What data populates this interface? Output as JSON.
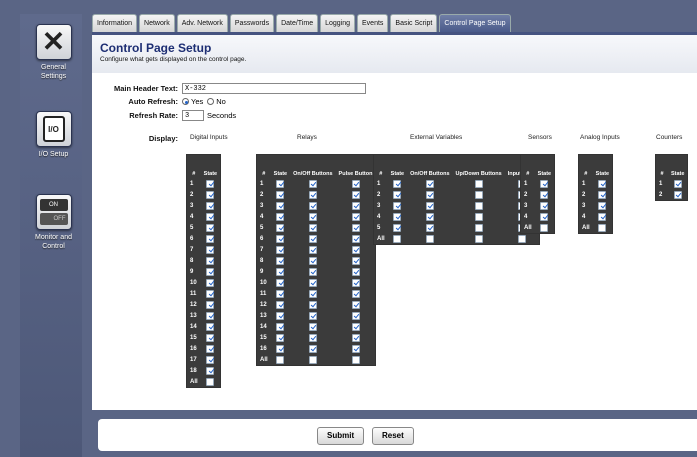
{
  "sidebar": [
    {
      "label": "General Settings",
      "icon": "tools-icon",
      "top": 0
    },
    {
      "label": "I/O Setup",
      "icon": "io-icon",
      "top": 0
    },
    {
      "label": "Monitor and Control",
      "icon": "toggle-icon",
      "top": 0
    }
  ],
  "tabs": [
    "Information",
    "Network",
    "Adv. Network",
    "Passwords",
    "Date/Time",
    "Logging",
    "Events",
    "Basic Script",
    "Control Page Setup"
  ],
  "active_tab": "Control Page Setup",
  "icons": {
    "io": "I/O",
    "on": "ON",
    "off": "OFF"
  },
  "page": {
    "title": "Control Page Setup",
    "subtitle": "Configure what gets displayed on the control page."
  },
  "form": {
    "header_label": "Main Header Text:",
    "header_value": "X-332",
    "refresh_label": "Auto Refresh:",
    "yes": "Yes",
    "no": "No",
    "refresh_selected": "Yes",
    "rate_label": "Refresh Rate:",
    "rate_value": "3",
    "rate_unit": "Seconds",
    "display_label": "Display:"
  },
  "groups": {
    "digital_inputs": {
      "title": "Digital Inputs",
      "headers": [
        "#",
        "State"
      ],
      "rows": [
        "1",
        "2",
        "3",
        "4",
        "5",
        "6",
        "7",
        "8",
        "9",
        "10",
        "11",
        "12",
        "13",
        "14",
        "15",
        "16",
        "17",
        "18",
        "All"
      ],
      "checked": [
        [
          1
        ],
        [
          1
        ],
        [
          1
        ],
        [
          1
        ],
        [
          1
        ],
        [
          1
        ],
        [
          1
        ],
        [
          1
        ],
        [
          1
        ],
        [
          1
        ],
        [
          1
        ],
        [
          1
        ],
        [
          1
        ],
        [
          1
        ],
        [
          1
        ],
        [
          1
        ],
        [
          1
        ],
        [
          1
        ],
        [
          0
        ]
      ]
    },
    "relays": {
      "title": "Relays",
      "headers": [
        "#",
        "State",
        "On/Off Buttons",
        "Pulse Button"
      ],
      "rows": [
        "1",
        "2",
        "3",
        "4",
        "5",
        "6",
        "7",
        "8",
        "9",
        "10",
        "11",
        "12",
        "13",
        "14",
        "15",
        "16",
        "All"
      ],
      "checked": [
        [
          1,
          1,
          1
        ],
        [
          1,
          1,
          1
        ],
        [
          1,
          1,
          1
        ],
        [
          1,
          1,
          1
        ],
        [
          1,
          1,
          1
        ],
        [
          1,
          1,
          1
        ],
        [
          1,
          1,
          1
        ],
        [
          1,
          1,
          1
        ],
        [
          1,
          1,
          1
        ],
        [
          1,
          1,
          1
        ],
        [
          1,
          1,
          1
        ],
        [
          1,
          1,
          1
        ],
        [
          1,
          1,
          1
        ],
        [
          1,
          1,
          1
        ],
        [
          1,
          1,
          1
        ],
        [
          1,
          1,
          1
        ],
        [
          0,
          0,
          0
        ]
      ]
    },
    "external_variables": {
      "title": "External Variables",
      "headers": [
        "#",
        "State",
        "On/Off Buttons",
        "Up/Down Buttons",
        "Input Field"
      ],
      "rows": [
        "1",
        "2",
        "3",
        "4",
        "5",
        "All"
      ],
      "checked": [
        [
          1,
          1,
          0,
          1
        ],
        [
          1,
          1,
          0,
          1
        ],
        [
          1,
          1,
          0,
          1
        ],
        [
          1,
          1,
          0,
          1
        ],
        [
          1,
          1,
          0,
          1
        ],
        [
          0,
          0,
          0,
          0
        ]
      ]
    },
    "sensors": {
      "title": "Sensors",
      "headers": [
        "#",
        "State"
      ],
      "rows": [
        "1",
        "2",
        "3",
        "4",
        "All"
      ],
      "checked": [
        [
          1
        ],
        [
          1
        ],
        [
          1
        ],
        [
          1
        ],
        [
          0
        ]
      ]
    },
    "analog_inputs": {
      "title": "Analog Inputs",
      "headers": [
        "#",
        "State"
      ],
      "rows": [
        "1",
        "2",
        "3",
        "4",
        "All"
      ],
      "checked": [
        [
          1
        ],
        [
          1
        ],
        [
          1
        ],
        [
          1
        ],
        [
          0
        ]
      ]
    },
    "counters": {
      "title": "Counters",
      "headers": [
        "#",
        "State"
      ],
      "rows": [
        "1",
        "2"
      ],
      "checked": [
        [
          1
        ],
        [
          1
        ]
      ]
    }
  },
  "buttons": {
    "submit": "Submit",
    "reset": "Reset"
  }
}
